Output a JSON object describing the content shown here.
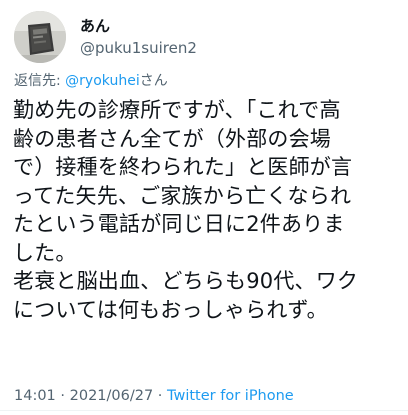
{
  "user": {
    "display_name": "あん",
    "handle": "@puku1suiren2"
  },
  "reply": {
    "prefix": "返信先: ",
    "mention": "@ryokuhei",
    "suffix": "さん"
  },
  "tweet": {
    "lines": [
      "勤め先の診療所ですが、「これで高",
      "齢の患者さん全てが（外部の会場",
      "で）接種を終わられた」と医師が言",
      "ってた矢先、ご家族から亡くなられ",
      "たという電話が同じ日に2件ありま",
      "した。",
      "老衰と脳出血、どちらも90代、ワク",
      "については何もおっしゃられず。"
    ]
  },
  "meta": {
    "time": "14:01",
    "sep1": " · ",
    "date": "2021/06/27",
    "sep2": " · ",
    "source": "Twitter for iPhone"
  },
  "colors": {
    "text": "#0f1419",
    "secondary": "#536471",
    "link": "#1d9bf0"
  },
  "icons": {
    "avatar": "profile-photo"
  }
}
